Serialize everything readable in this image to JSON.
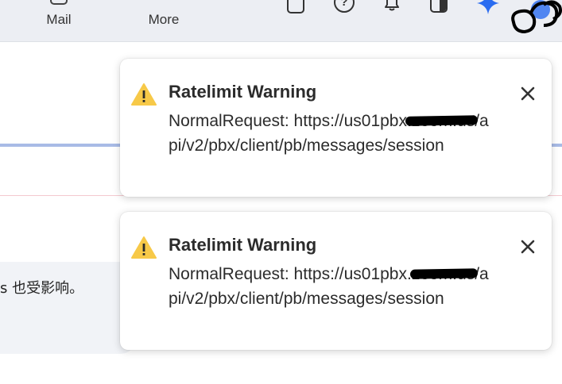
{
  "topbar": {
    "nav": [
      {
        "label": "Mail"
      },
      {
        "label": "More"
      }
    ],
    "icons": [
      "square-icon",
      "help-icon",
      "bell-icon",
      "panel-icon",
      "sparkle-icon",
      "avatar"
    ],
    "help_glyph": "?"
  },
  "background": {
    "bubble_text": "s 也受影响。"
  },
  "toasts": [
    {
      "title": "Ratelimit Warning",
      "message_prefix": "NormalRequest: https://us01pbx",
      "redacted_text": ".zoom.us",
      "message_suffix": "/api/v2/pbx/client/pb/messages/session"
    },
    {
      "title": "Ratelimit Warning",
      "message_prefix": "NormalRequest: https://us01pbx.",
      "redacted_text": "zoom.us",
      "message_suffix": "/api/v2/pbx/client/pb/messages/session"
    }
  ],
  "colors": {
    "warning": "#f7c948",
    "sparkle": "#2a6cf0",
    "accent_line": "#a8bbe6"
  }
}
